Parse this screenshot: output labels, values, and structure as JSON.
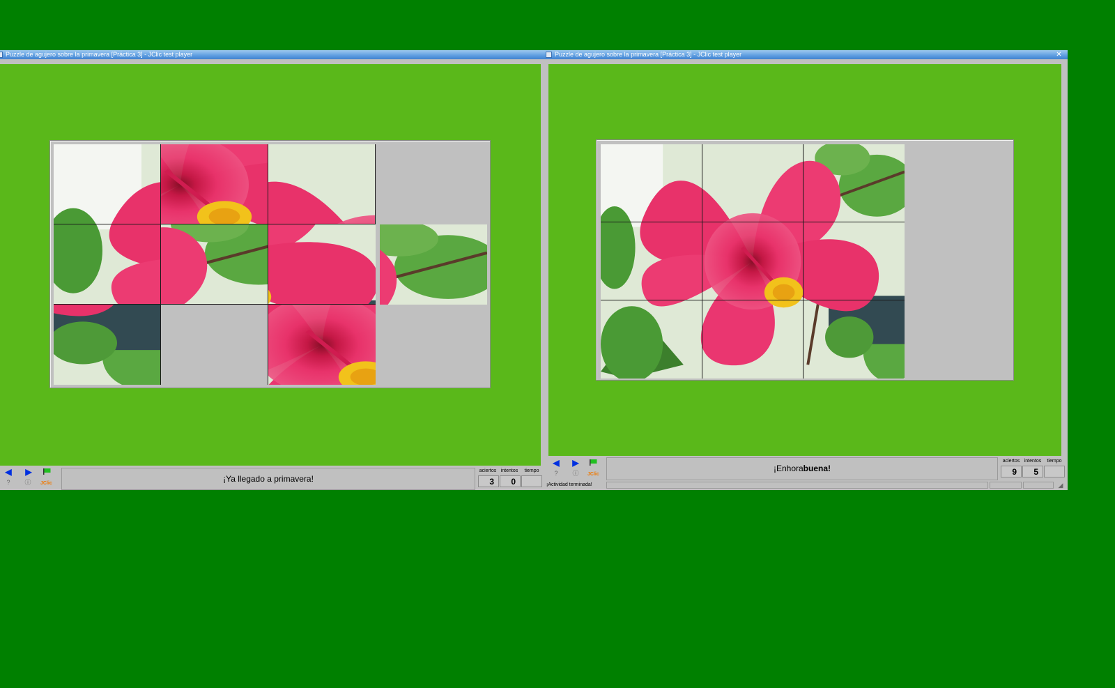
{
  "left_window": {
    "title": "Puzzle de agujero sobre la primavera [Práctica 3] - JClic test player",
    "message": "¡Ya llegado a primavera!",
    "counters": {
      "labels": [
        "aciertos",
        "intentos",
        "tiempo"
      ],
      "values": [
        "3",
        "0",
        ""
      ]
    },
    "jclic_label": "JClic"
  },
  "right_window": {
    "title": "Puzzle de agujero sobre la primavera [Práctica 3] - JClic test player",
    "message_normal": "¡Enhora",
    "message_bold": "buena!",
    "status_text": "¡Actividad terminada!",
    "counters": {
      "labels": [
        "aciertos",
        "intentos",
        "tiempo"
      ],
      "values": [
        "9",
        "5",
        ""
      ]
    },
    "jclic_label": "JClic"
  },
  "icons": {
    "back": "arrow-left-icon",
    "forward": "arrow-right-icon",
    "help": "question-icon",
    "info": "info-icon",
    "flag": "green-flag-icon",
    "close": "close-icon"
  },
  "colors": {
    "desktop": "#008000",
    "stage": "#5ab81a",
    "board": "#c0c0c0",
    "petal": "#e8326a",
    "leaf": "#3f8f2f",
    "stamen": "#f2c21b"
  }
}
